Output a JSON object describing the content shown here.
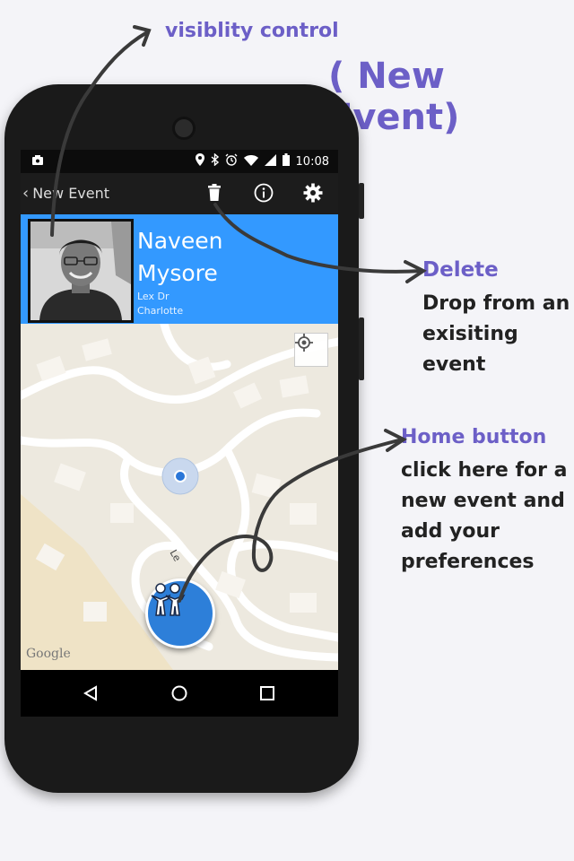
{
  "annotations": {
    "title": "( New Event)",
    "visibility": "visiblity control",
    "delete_title": "Delete",
    "delete_desc": "Drop from an exisiting event",
    "home_title": "Home button",
    "home_desc": "click here for a new event and add your preferences"
  },
  "status_bar": {
    "time": "10:08",
    "icons": [
      "notification-icon",
      "location-icon",
      "bluetooth-icon",
      "alarm-icon",
      "wifi-icon",
      "signal-icon",
      "battery-icon"
    ]
  },
  "action_bar": {
    "title": "New Event",
    "icons": [
      "trash-icon",
      "info-icon",
      "gear-icon"
    ]
  },
  "profile": {
    "first_name": "Naveen",
    "last_name": "Mysore",
    "address_line1": "Lex Dr",
    "address_line2": "Charlotte"
  },
  "map": {
    "attribution": "Google",
    "street_label": "Le"
  },
  "colors": {
    "accent": "#3399ff",
    "annotation_purple": "#6c5fc7",
    "action_bar": "#1c1c1c"
  }
}
